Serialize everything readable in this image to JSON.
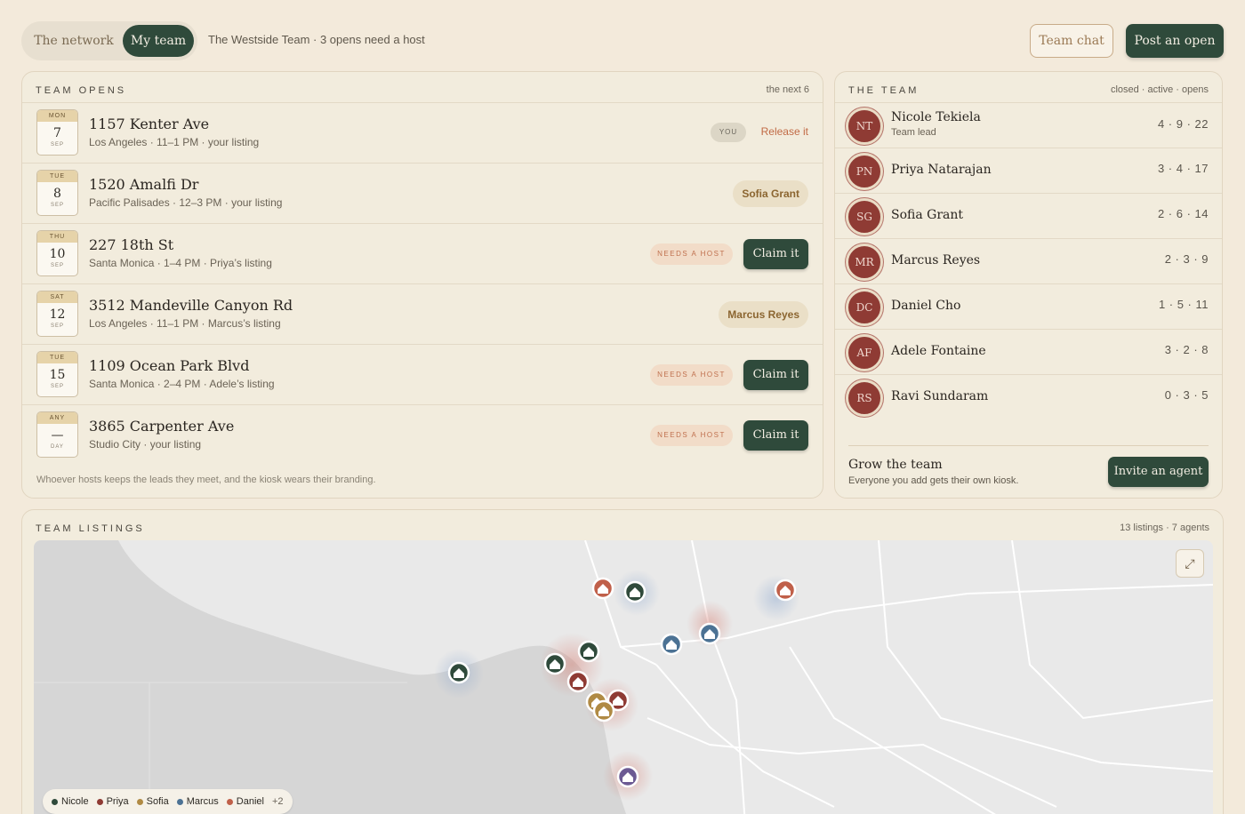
{
  "topbar": {
    "tabs": [
      {
        "label": "The network",
        "active": false
      },
      {
        "label": "My team",
        "active": true
      }
    ],
    "subtitle": "The Westside Team · 3 opens need a host",
    "team_chat": "Team chat",
    "post_open": "Post an open"
  },
  "opens": {
    "title": "TEAM OPENS",
    "meta": "the next 6",
    "rows": [
      {
        "dow": "MON",
        "day": "7",
        "mon": "SEP",
        "address": "1157 Kenter Ave",
        "detail": "Los Angeles · 11–1 PM · your listing",
        "state": "you",
        "you_label": "YOU",
        "release_label": "Release it"
      },
      {
        "dow": "TUE",
        "day": "8",
        "mon": "SEP",
        "address": "1520 Amalfi Dr",
        "detail": "Pacific Palisades · 12–3 PM · your listing",
        "state": "host",
        "host": "Sofia Grant"
      },
      {
        "dow": "THU",
        "day": "10",
        "mon": "SEP",
        "address": "227 18th St",
        "detail": "Santa Monica · 1–4 PM · Priya’s listing",
        "state": "needs",
        "needs_label": "NEEDS A HOST",
        "claim_label": "Claim it"
      },
      {
        "dow": "SAT",
        "day": "12",
        "mon": "SEP",
        "address": "3512 Mandeville Canyon Rd",
        "detail": "Los Angeles · 11–1 PM · Marcus’s listing",
        "state": "host",
        "host": "Marcus Reyes"
      },
      {
        "dow": "TUE",
        "day": "15",
        "mon": "SEP",
        "address": "1109 Ocean Park Blvd",
        "detail": "Santa Monica · 2–4 PM · Adele’s listing",
        "state": "needs",
        "needs_label": "NEEDS A HOST",
        "claim_label": "Claim it"
      },
      {
        "dow": "ANY",
        "day": "—",
        "mon": "DAY",
        "address": "3865 Carpenter Ave",
        "detail": "Studio City · your listing",
        "state": "needs",
        "needs_label": "NEEDS A HOST",
        "claim_label": "Claim it"
      }
    ],
    "footnote": "Whoever hosts keeps the leads they meet, and the kiosk wears their branding."
  },
  "team": {
    "title": "THE TEAM",
    "meta": "closed · active · opens",
    "members": [
      {
        "initials": "NT",
        "name": "Nicole Tekiela",
        "role": "Team lead",
        "stats": "4 · 9 · 22"
      },
      {
        "initials": "PN",
        "name": "Priya Natarajan",
        "role": "",
        "stats": "3 · 4 · 17"
      },
      {
        "initials": "SG",
        "name": "Sofia Grant",
        "role": "",
        "stats": "2 · 6 · 14"
      },
      {
        "initials": "MR",
        "name": "Marcus Reyes",
        "role": "",
        "stats": "2 · 3 · 9"
      },
      {
        "initials": "DC",
        "name": "Daniel Cho",
        "role": "",
        "stats": "1 · 5 · 11"
      },
      {
        "initials": "AF",
        "name": "Adele Fontaine",
        "role": "",
        "stats": "3 · 2 · 8"
      },
      {
        "initials": "RS",
        "name": "Ravi Sundaram",
        "role": "",
        "stats": "0 · 3 · 5"
      }
    ],
    "grow_title": "Grow the team",
    "grow_sub": "Everyone you add gets their own kiosk.",
    "invite_label": "Invite an agent"
  },
  "listings": {
    "title": "TEAM LISTINGS",
    "meta": "13 listings · 7 agents",
    "legend": [
      {
        "name": "Nicole",
        "color": "#2f4a3b"
      },
      {
        "name": "Priya",
        "color": "#8f3b34"
      },
      {
        "name": "Sofia",
        "color": "#b08a44"
      },
      {
        "name": "Marcus",
        "color": "#4c7294"
      },
      {
        "name": "Daniel",
        "color": "#c0604a"
      }
    ],
    "legend_more": "+2"
  },
  "colors": {
    "accent_green": "#2f4a3b",
    "avatar_red": "#8f3b34",
    "warning": "#c0714f"
  }
}
